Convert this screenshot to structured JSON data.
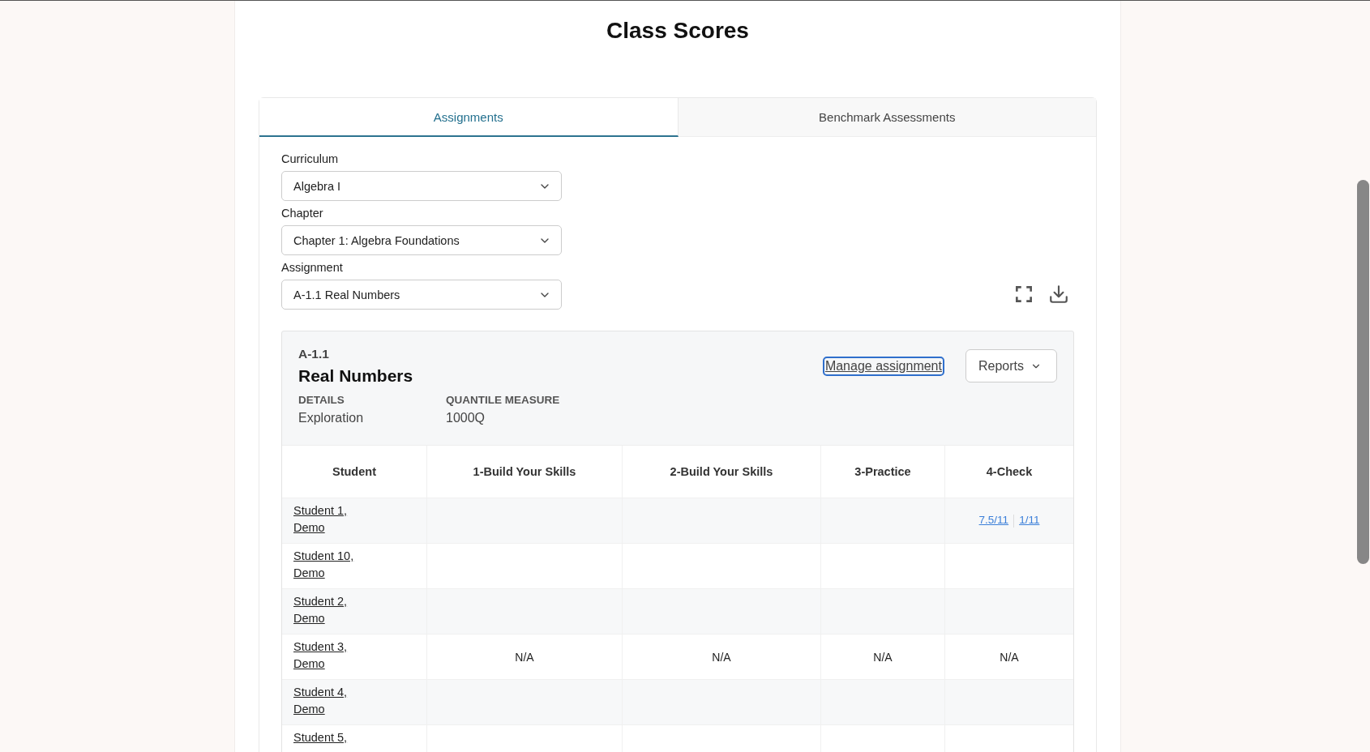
{
  "page": {
    "title": "Class Scores"
  },
  "tabs": [
    {
      "label": "Assignments",
      "selected": true
    },
    {
      "label": "Benchmark Assessments",
      "selected": false
    }
  ],
  "filters": [
    {
      "label": "Curriculum",
      "value": "Algebra I"
    },
    {
      "label": "Chapter",
      "value": "Chapter 1: Algebra Foundations"
    },
    {
      "label": "Assignment",
      "value": "A-1.1 Real Numbers"
    }
  ],
  "assignment": {
    "code": "A-1.1",
    "title": "Real Numbers",
    "manage_link": {
      "label": "Manage assignment",
      "focused": true
    },
    "reports_button": "Reports",
    "details": [
      {
        "label": "DETAILS",
        "value": "Exploration"
      },
      {
        "label": "QUANTILE MEASURE",
        "value": "1000Q"
      }
    ]
  },
  "table": {
    "columns": [
      "Student",
      "1-Build Your Skills",
      "2-Build Your Skills",
      "3-Practice",
      "4-Check"
    ],
    "rows": [
      {
        "cells": [
          {
            "kind": "student",
            "text": "Student 1, Demo"
          },
          {
            "kind": "empty"
          },
          {
            "kind": "empty"
          },
          {
            "kind": "empty"
          },
          {
            "kind": "scores",
            "links": [
              "7.5/11",
              "1/11"
            ]
          }
        ]
      },
      {
        "cells": [
          {
            "kind": "student",
            "text": "Student 10, Demo"
          },
          {
            "kind": "empty"
          },
          {
            "kind": "empty"
          },
          {
            "kind": "empty"
          },
          {
            "kind": "empty"
          }
        ]
      },
      {
        "cells": [
          {
            "kind": "student",
            "text": "Student 2, Demo"
          },
          {
            "kind": "empty"
          },
          {
            "kind": "empty"
          },
          {
            "kind": "empty"
          },
          {
            "kind": "empty"
          }
        ]
      },
      {
        "cells": [
          {
            "kind": "student",
            "text": "Student 3, Demo"
          },
          {
            "kind": "text",
            "text": "N/A"
          },
          {
            "kind": "text",
            "text": "N/A"
          },
          {
            "kind": "text",
            "text": "N/A"
          },
          {
            "kind": "text",
            "text": "N/A"
          }
        ]
      },
      {
        "cells": [
          {
            "kind": "student",
            "text": "Student 4, Demo"
          },
          {
            "kind": "empty"
          },
          {
            "kind": "empty"
          },
          {
            "kind": "empty"
          },
          {
            "kind": "empty"
          }
        ]
      },
      {
        "cells": [
          {
            "kind": "student",
            "text": "Student 5,"
          },
          {
            "kind": "empty"
          },
          {
            "kind": "empty"
          },
          {
            "kind": "empty"
          },
          {
            "kind": "empty"
          }
        ]
      }
    ]
  }
}
